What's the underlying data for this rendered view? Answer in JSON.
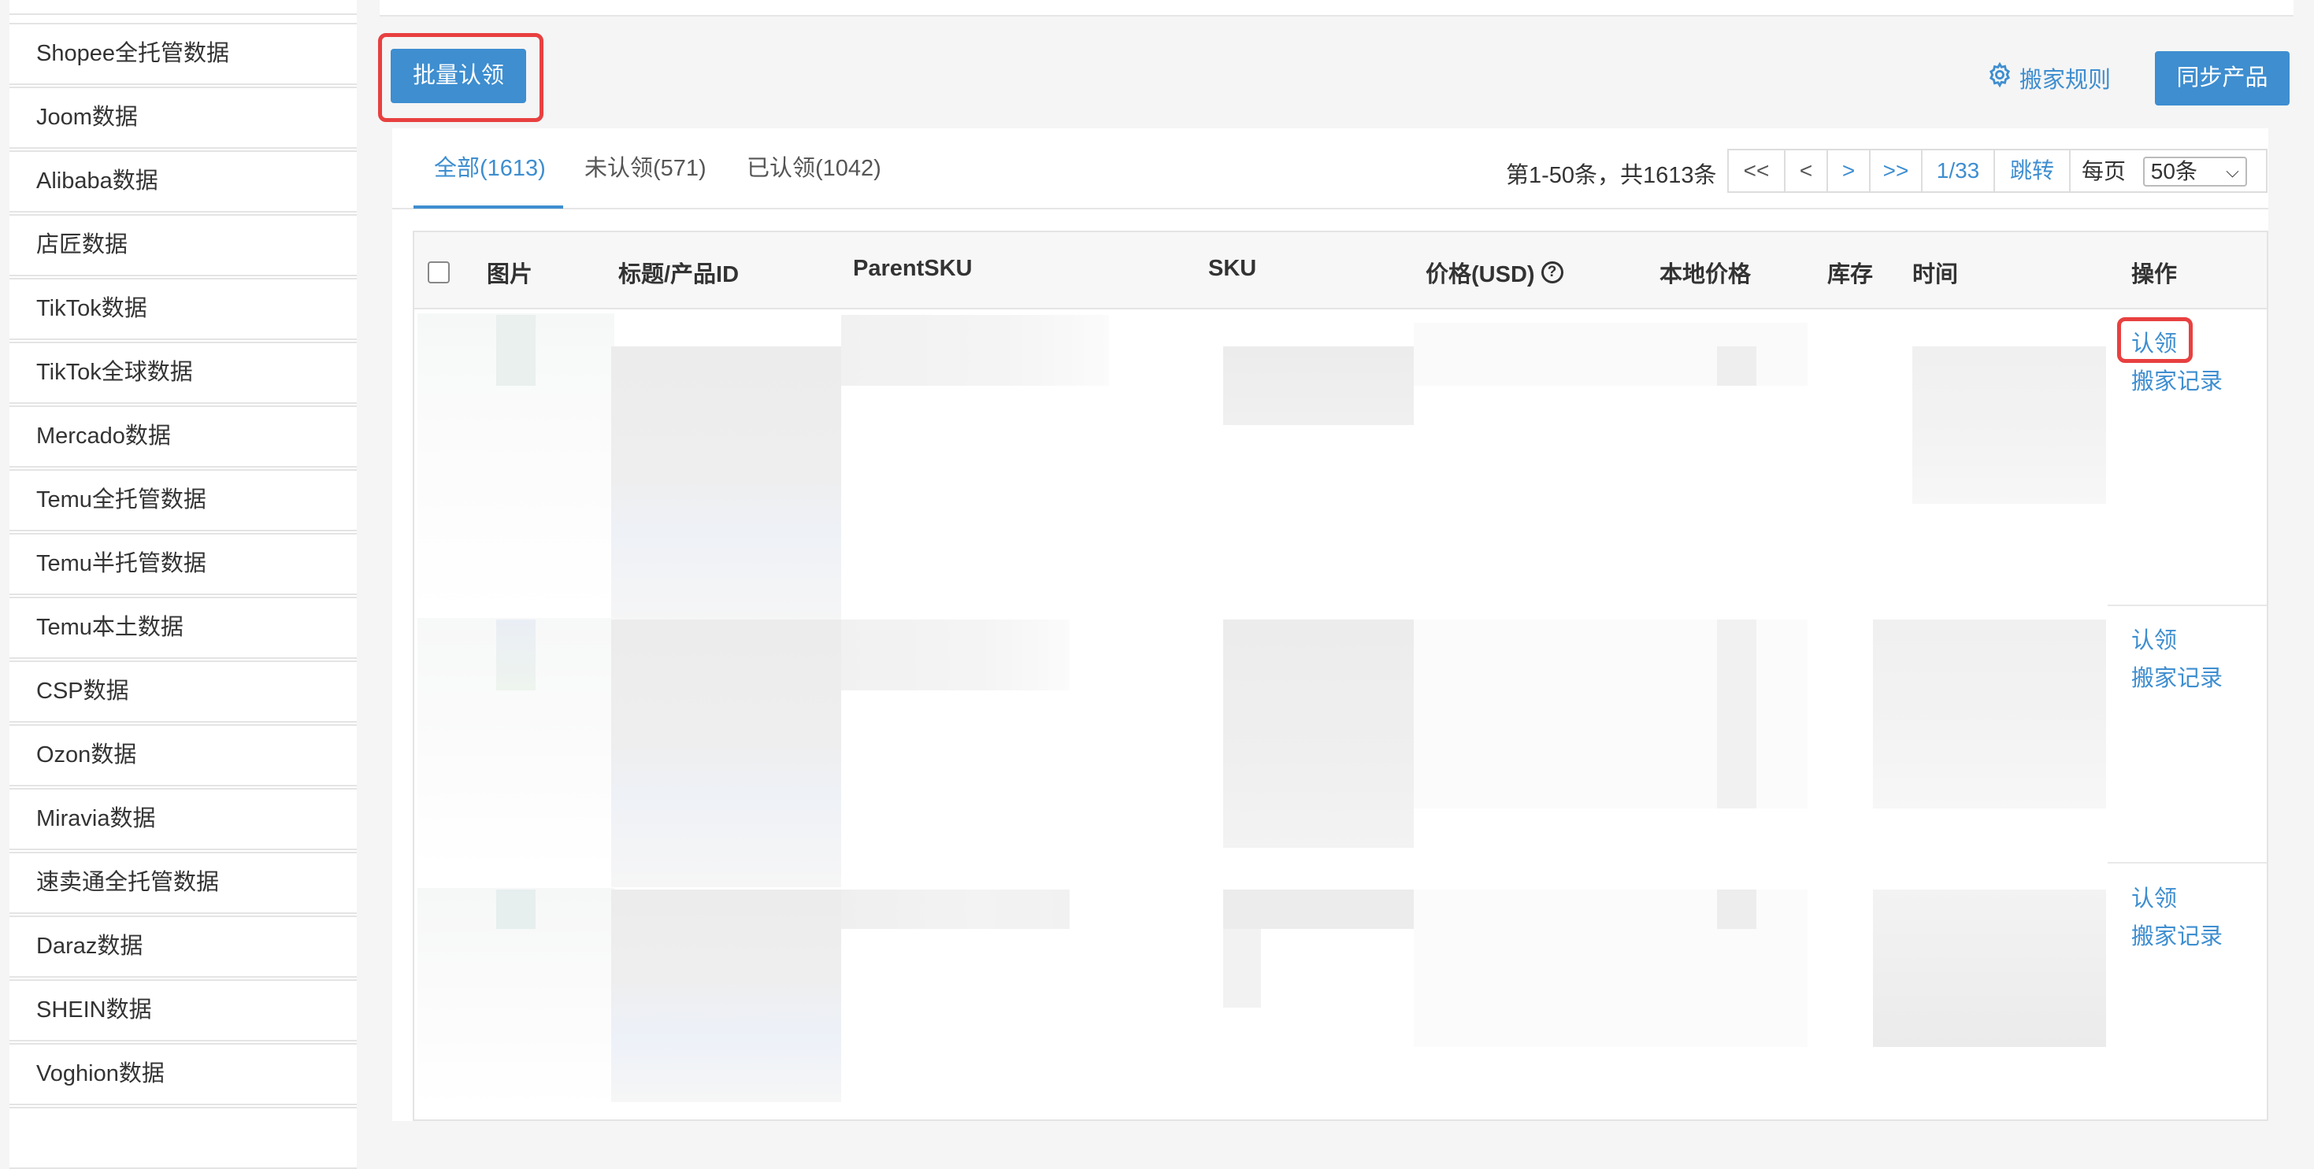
{
  "sidebar": {
    "items": [
      {
        "label": "Shopee全托管数据"
      },
      {
        "label": "Shopee全托管数据"
      },
      {
        "label": "Joom数据"
      },
      {
        "label": "Alibaba数据"
      },
      {
        "label": "店匠数据"
      },
      {
        "label": "TikTok数据"
      },
      {
        "label": "TikTok全球数据"
      },
      {
        "label": "Mercado数据"
      },
      {
        "label": "Temu全托管数据"
      },
      {
        "label": "Temu半托管数据"
      },
      {
        "label": "Temu本土数据"
      },
      {
        "label": "CSP数据"
      },
      {
        "label": "Ozon数据"
      },
      {
        "label": "Miravia数据"
      },
      {
        "label": "速卖通全托管数据"
      },
      {
        "label": "Daraz数据"
      },
      {
        "label": "SHEIN数据"
      },
      {
        "label": "Voghion数据"
      }
    ]
  },
  "toolbar": {
    "batch_claim": "批量认领",
    "move_rules": "搬家规则",
    "sync_products": "同步产品"
  },
  "tabs": [
    {
      "label": "全部(1613)",
      "active": true
    },
    {
      "label": "未认领(571)",
      "active": false
    },
    {
      "label": "已认领(1042)",
      "active": false
    }
  ],
  "pagination": {
    "info": "第1-50条，共1613条",
    "first": "<<",
    "prev": "<",
    "next": ">",
    "last": ">>",
    "page": "1/33",
    "jump": "跳转",
    "per_page_label": "每页",
    "per_page_value": "50条"
  },
  "table": {
    "headers": [
      "图片",
      "标题/产品ID",
      "ParentSKU",
      "SKU",
      "价格(USD)",
      "本地价格",
      "库存",
      "时间",
      "操作"
    ],
    "rows": [
      {
        "claim": "认领",
        "history": "搬家记录"
      },
      {
        "claim": "认领",
        "history": "搬家记录"
      },
      {
        "claim": "认领",
        "history": "搬家记录"
      }
    ]
  },
  "colors": {
    "accent": "#3e8ed0",
    "highlight": "#e84040"
  }
}
